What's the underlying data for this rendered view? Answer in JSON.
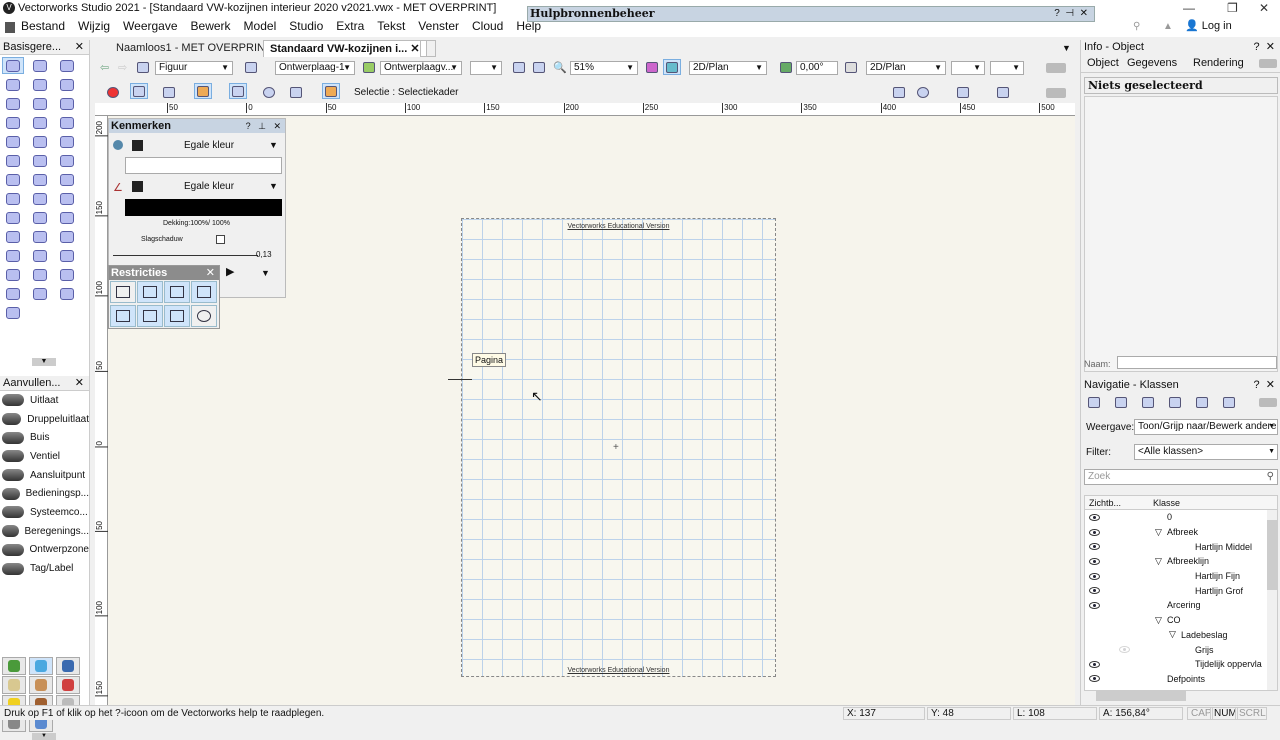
{
  "window": {
    "title": "Vectorworks Studio 2021 - [Standaard VW-kozijnen interieur 2020 v2021.vwx - MET OVERPRINT]",
    "logo": "V",
    "login": "Log in"
  },
  "menu": [
    "Bestand",
    "Wijzig",
    "Weergave",
    "Bewerk",
    "Model",
    "Studio",
    "Extra",
    "Tekst",
    "Venster",
    "Cloud",
    "Help"
  ],
  "resource_manager": {
    "title": "Hulpbronnenbeheer"
  },
  "left_palette": {
    "title": "Basisgere...",
    "tools": [
      "selection",
      "pan",
      "flyover",
      "zoom",
      "text",
      "callout",
      "delete",
      "extrude",
      "line",
      "double-line",
      "rectangle",
      "rounded-rect",
      "circle",
      "oval",
      "arc",
      "freehand",
      "polyline",
      "polygon",
      "poly-2d",
      "regular-polygon",
      "spiral",
      "eyedropper",
      "magic-wand",
      "visibility",
      "move",
      "reshape",
      "rotate",
      "mirror",
      "split",
      "offset",
      "fillet",
      "connect",
      "trim",
      "scissors",
      "chamfer",
      "clip",
      "extend",
      "eraser",
      "dimension",
      "cylinder"
    ],
    "tools_title2": "Aanvullen...",
    "items": [
      "Uitlaat",
      "Druppeluitlaat",
      "Buis",
      "Ventiel",
      "Aansluitpunt",
      "Bedieningsp...",
      "Systeemco...",
      "Beregenings...",
      "Ontwerpzone",
      "Tag/Label"
    ],
    "sets": [
      {
        "icon": "site",
        "color": "#4a9a3a"
      },
      {
        "icon": "water",
        "color": "#4aa8e0"
      },
      {
        "icon": "globe",
        "color": "#3a6ab0"
      },
      {
        "icon": "plan",
        "color": "#d8c890"
      },
      {
        "icon": "house",
        "color": "#c89058"
      },
      {
        "icon": "shapes",
        "color": "#d04040"
      },
      {
        "icon": "light",
        "color": "#f0d020"
      },
      {
        "icon": "furniture",
        "color": "#a06030"
      },
      {
        "icon": "pipe",
        "color": "#bbbbbb"
      },
      {
        "icon": "beam",
        "color": "#888888"
      },
      {
        "icon": "fitting",
        "color": "#5a8ad0"
      }
    ]
  },
  "tabs": [
    {
      "label": "Naamloos1 - MET OVERPRINT",
      "active": false
    },
    {
      "label": "Standaard VW-kozijnen i...",
      "active": true
    }
  ],
  "view_bar": {
    "class": "Figuur",
    "layer": "Ontwerplaag-1",
    "layer2": "Ontwerplaagv...",
    "zoom": "51%",
    "view": "2D/Plan",
    "angle": "0,00°",
    "render": "2D/Plan"
  },
  "mode_bar": {
    "mode_text": "Selectie : Selectiekader"
  },
  "rulers": {
    "top": [
      "50",
      "0",
      "50",
      "100",
      "150",
      "200",
      "250",
      "300",
      "350",
      "400",
      "450",
      "500"
    ],
    "left": [
      "200",
      "150",
      "100",
      "50",
      "0",
      "50",
      "100",
      "150"
    ]
  },
  "canvas": {
    "watermark": "Vectorworks Educational Version",
    "page_label": "Pagina",
    "grid_color": "#bcd2ea",
    "background": "#f6f4ec"
  },
  "attributes": {
    "title": "Kenmerken",
    "fill": "Egale kleur",
    "pen": "Egale kleur",
    "opacity": "Dekking:100%/ 100%",
    "shadow": "Slagschaduw",
    "line_weight": "0,13"
  },
  "constraints": {
    "title": "Restricties"
  },
  "info": {
    "title": "Info - Object",
    "tabs": [
      "Object",
      "Gegevens",
      "Rendering"
    ],
    "selection": "Niets geselecteerd",
    "name_label": "Naam:"
  },
  "nav": {
    "title": "Navigatie - Klassen",
    "view_label": "Weergave:",
    "view_value": "Toon/Grijp naar/Bewerk andere",
    "filter_label": "Filter:",
    "filter_value": "<Alle klassen>",
    "search_placeholder": "Zoek",
    "col_vis": "Zichtb...",
    "col_class": "Klasse",
    "rows": [
      {
        "name": "0",
        "level": 0,
        "expander": "",
        "eye": true
      },
      {
        "name": "Afbreek",
        "level": 0,
        "expander": "▽",
        "eye": true
      },
      {
        "name": "Hartlijn Middel",
        "level": 1,
        "expander": "",
        "eye": true
      },
      {
        "name": "Afbreeklijn",
        "level": 0,
        "expander": "▽",
        "eye": true
      },
      {
        "name": "Hartlijn Fijn",
        "level": 1,
        "expander": "",
        "eye": true
      },
      {
        "name": "Hartlijn Grof",
        "level": 1,
        "expander": "",
        "eye": true
      },
      {
        "name": "Arcering",
        "level": 0,
        "expander": "",
        "eye": true
      },
      {
        "name": "CO",
        "level": 0,
        "expander": "▽",
        "eye": false
      },
      {
        "name": "Ladebeslag",
        "level": 1,
        "expander": "▽",
        "eye": false
      },
      {
        "name": "Grijs",
        "level": 2,
        "expander": "",
        "eye": "faint"
      },
      {
        "name": "Tijdelijk oppervla",
        "level": 2,
        "expander": "",
        "eye": true
      },
      {
        "name": "Defpoints",
        "level": 0,
        "expander": "",
        "eye": true
      }
    ]
  },
  "status": {
    "help": "Druk op F1 of klik op het ?-icoon om de Vectorworks help te raadplegen.",
    "x": "X: 137",
    "y": "Y: 48",
    "l": "L: 108",
    "a": "A: 156,84°",
    "cap": "CAP",
    "num": "NUM",
    "scrl": "SCRL"
  }
}
